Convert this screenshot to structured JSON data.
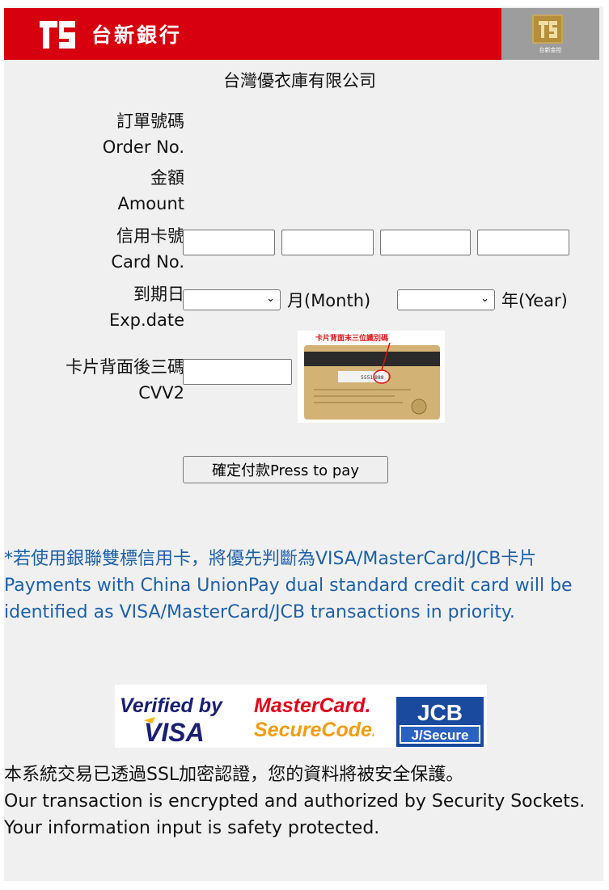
{
  "header": {
    "bank_name": "台新銀行",
    "holding_name": "台新金控"
  },
  "merchant": "台灣優衣庫有限公司",
  "form": {
    "order_label_zh": "訂單號碼",
    "order_label_en": "Order No.",
    "amount_label_zh": "金額",
    "amount_label_en": "Amount",
    "card_label_zh": "信用卡號",
    "card_label_en": "Card No.",
    "exp_label_zh": "到期日",
    "exp_label_en": "Exp.date",
    "month_unit": "月(Month)",
    "year_unit": "年(Year)",
    "month_value": "",
    "year_value": "",
    "cvv_label_zh": "卡片背面後三碼",
    "cvv_label_en": "CVV2",
    "cvv_image_caption": "卡片背面末三位識別碼",
    "pay_button": "確定付款Press to pay"
  },
  "notice": "*若使用銀聯雙標信用卡，將優先判斷為VISA/MasterCard/JCB卡片Payments with China UnionPay dual standard credit card will be identified as VISA/MasterCard/JCB transactions in priority.",
  "badges": {
    "visa_line1": "Verified by",
    "visa_line2": "VISA",
    "mc_line1": "MasterCard.",
    "mc_line2": "SecureCode.",
    "jcb_line1": "JCB",
    "jcb_line2": "J/Secure"
  },
  "ssl_notice": {
    "zh": "本系統交易已透過SSL加密認證，您的資料將被安全保護。",
    "en": "Our transaction is encrypted and authorized by Security Sockets. Your information input is safety protected."
  },
  "colors": {
    "brand_red": "#d7000f",
    "notice_blue": "#1d60a8",
    "holding_gray": "#9d9d9d"
  }
}
